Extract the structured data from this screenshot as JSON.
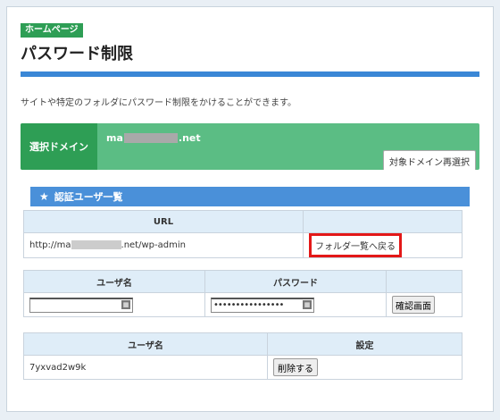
{
  "header": {
    "badge": "ホームページ",
    "title": "パスワード制限",
    "description": "サイトや特定のフォルダにパスワード制限をかけることができます。"
  },
  "domain": {
    "label": "選択ドメイン",
    "value_prefix": "ma",
    "value_suffix": ".net",
    "reselect_button": "対象ドメイン再選択"
  },
  "section": {
    "title": "認証ユーザ一覧",
    "icon": "star-icon"
  },
  "url_table": {
    "header": "URL",
    "url_prefix": "http://ma",
    "url_suffix": ".net/wp-admin",
    "back_link": "フォルダ一覧へ戻る"
  },
  "input_table": {
    "headers": [
      "ユーザ名",
      "パスワード"
    ],
    "username_value": "",
    "password_value": "••••••••••••••••",
    "confirm_button": "確認画面"
  },
  "users_table": {
    "headers": [
      "ユーザ名",
      "設定"
    ],
    "rows": [
      {
        "username": "7yxvad2w9k",
        "action": "削除する"
      }
    ]
  },
  "colors": {
    "accent_blue": "#3a87d6",
    "green_dark": "#2e9e55",
    "green_light": "#5bbd84",
    "highlight_red": "#e31818"
  }
}
